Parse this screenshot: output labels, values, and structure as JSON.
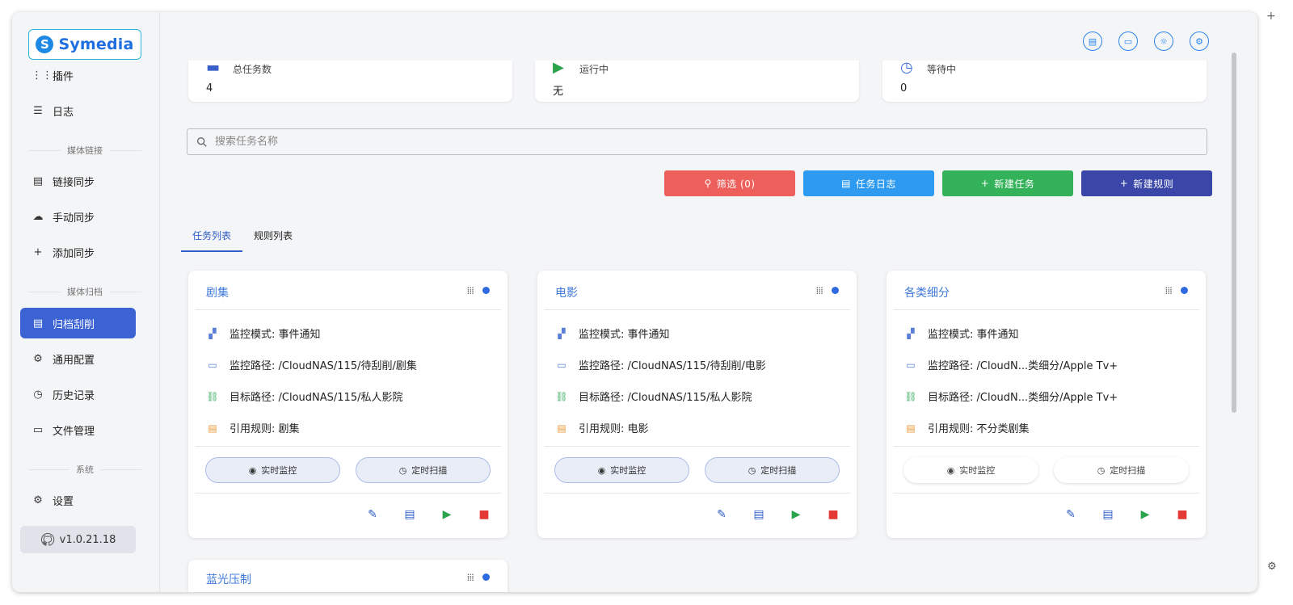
{
  "brand": {
    "name": "Symedia",
    "mark": "S"
  },
  "sidebar": {
    "items": [
      {
        "label": "插件",
        "icon": "⋮⋮⋮"
      },
      {
        "label": "日志",
        "icon": "☰"
      },
      {
        "label": "链接同步",
        "icon": "▤"
      },
      {
        "label": "手动同步",
        "icon": "☁"
      },
      {
        "label": "添加同步",
        "icon": "+"
      },
      {
        "label": "归档刮削",
        "icon": "▤"
      },
      {
        "label": "通用配置",
        "icon": "⚙"
      },
      {
        "label": "历史记录",
        "icon": "◷"
      },
      {
        "label": "文件管理",
        "icon": "▭"
      },
      {
        "label": "设置",
        "icon": "⚙"
      }
    ],
    "sections": [
      "媒体链接",
      "媒体归档",
      "系统"
    ],
    "version": "v1.0.21.18"
  },
  "stats": [
    {
      "label": "总任务数",
      "value": "4"
    },
    {
      "label": "运行中",
      "value": "无"
    },
    {
      "label": "等待中",
      "value": "0"
    }
  ],
  "search": {
    "placeholder": "搜索任务名称"
  },
  "actions": {
    "filter": "筛选 (0)",
    "task_log": "任务日志",
    "new_task": "新建任务",
    "new_rule": "新建规则"
  },
  "tabs": [
    "任务列表",
    "规则列表"
  ],
  "cards": [
    {
      "title": "剧集",
      "mode": "监控模式: 事件通知",
      "path": "监控路径: /CloudNAS/115/待刮削/剧集",
      "target": "目标路径: /CloudNAS/115/私人影院",
      "rule": "引用规则: 剧集",
      "realtime": "实时监控",
      "scheduled": "定时扫描"
    },
    {
      "title": "电影",
      "mode": "监控模式: 事件通知",
      "path": "监控路径: /CloudNAS/115/待刮削/电影",
      "target": "目标路径: /CloudNAS/115/私人影院",
      "rule": "引用规则: 电影",
      "realtime": "实时监控",
      "scheduled": "定时扫描"
    },
    {
      "title": "各类细分",
      "mode": "监控模式: 事件通知",
      "path": "监控路径: /CloudN...类细分/Apple Tv+",
      "target": "目标路径: /CloudN...类细分/Apple Tv+",
      "rule": "引用规则: 不分类剧集",
      "realtime": "实时监控",
      "scheduled": "定时扫描"
    }
  ],
  "partial_card": {
    "title": "蓝光压制"
  },
  "colors": {
    "accent": "#3b63d3",
    "filter": "#ec5f5a",
    "task_log": "#2f9bf0",
    "new_task": "#33b25a",
    "new_rule": "#3a47a8"
  }
}
